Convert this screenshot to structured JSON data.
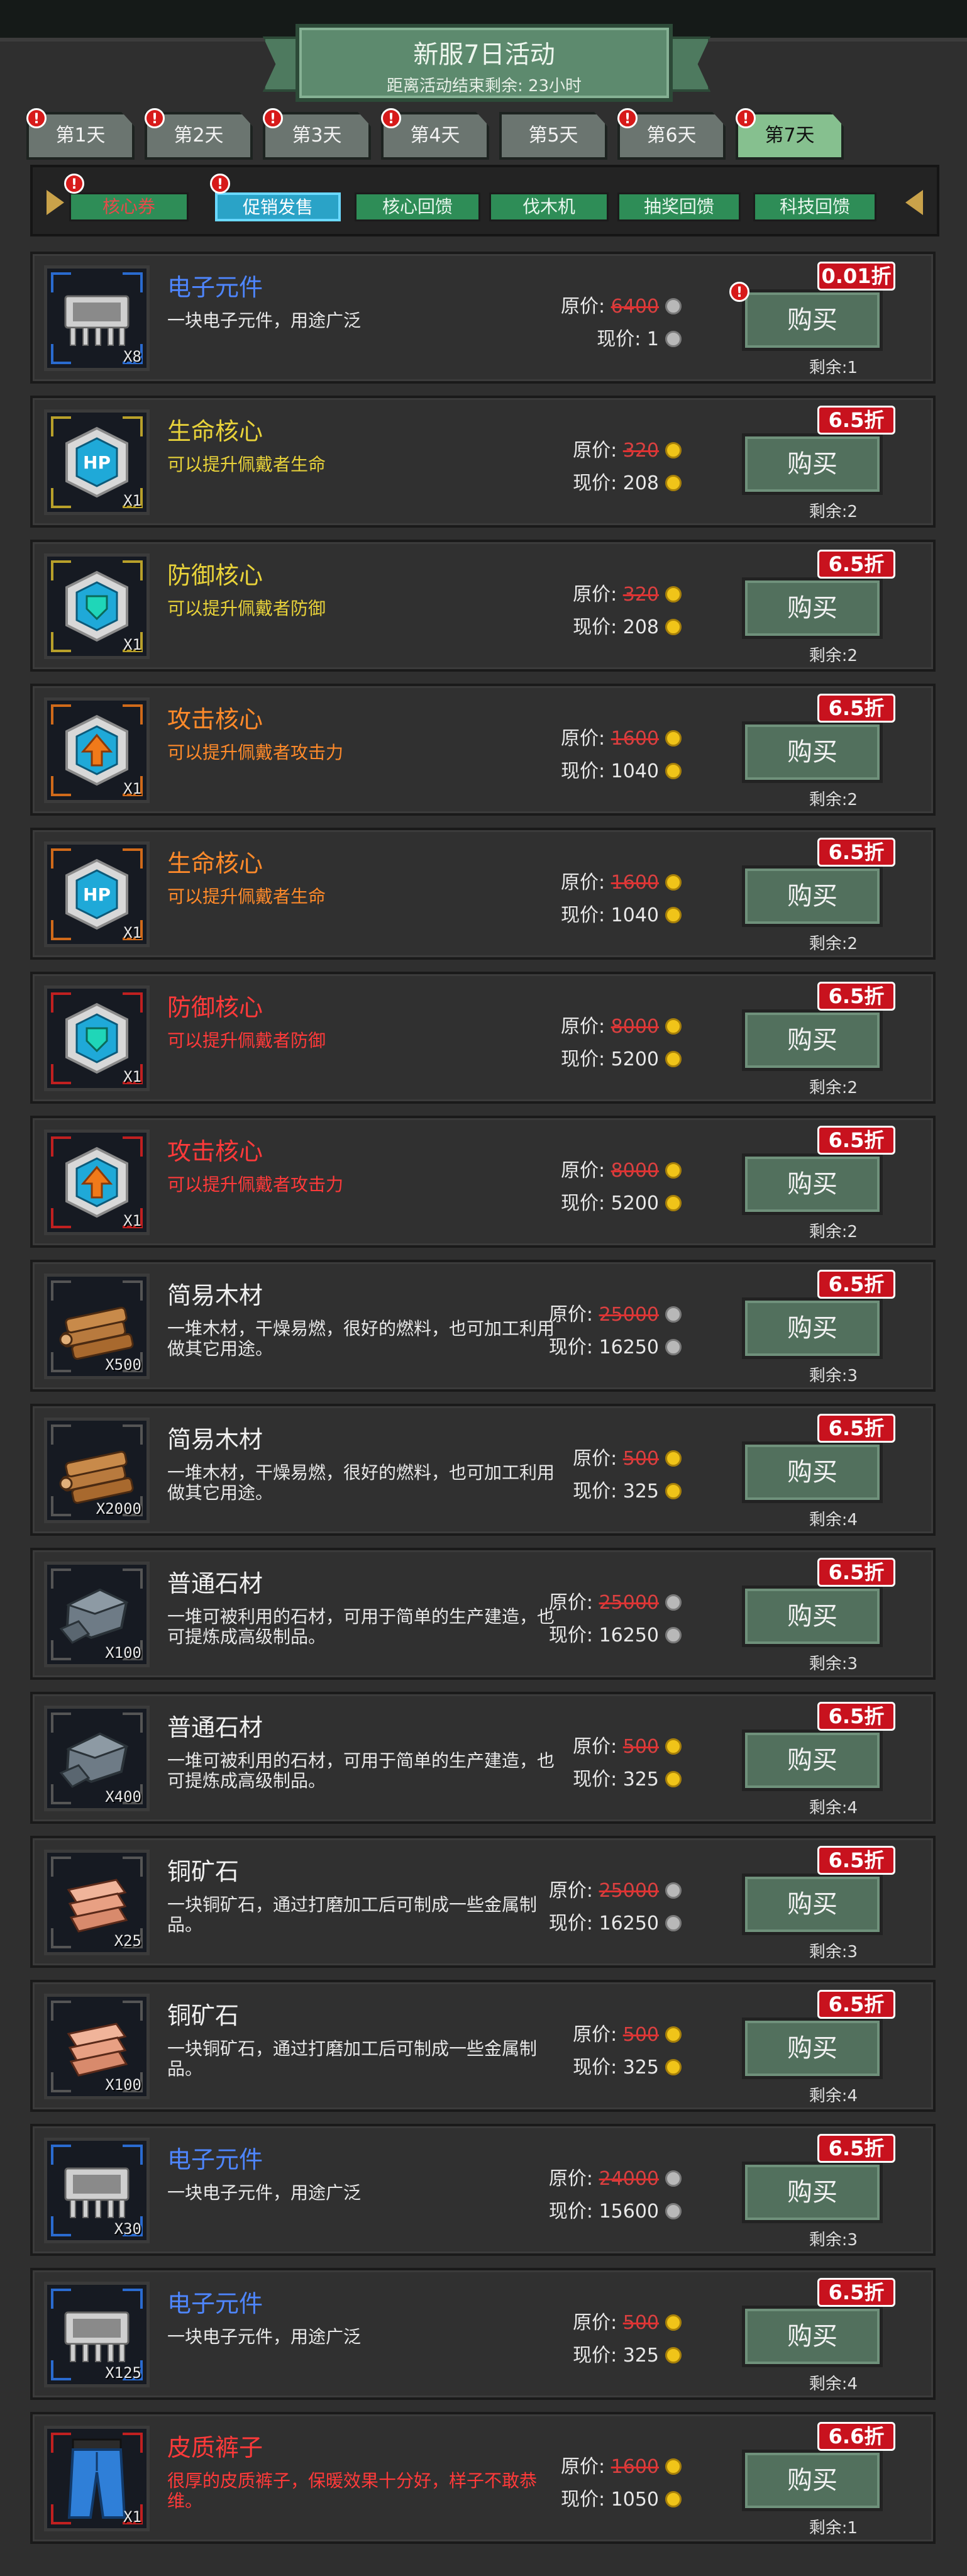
{
  "header": {
    "title": "新服7日活动",
    "subtitle": "距离活动结束剩余: 23小时"
  },
  "day_tabs": [
    {
      "label": "第1天",
      "alert": true,
      "active": false
    },
    {
      "label": "第2天",
      "alert": true,
      "active": false
    },
    {
      "label": "第3天",
      "alert": true,
      "active": false
    },
    {
      "label": "第4天",
      "alert": true,
      "active": false
    },
    {
      "label": "第5天",
      "alert": false,
      "active": false
    },
    {
      "label": "第6天",
      "alert": true,
      "active": false
    },
    {
      "label": "第7天",
      "alert": true,
      "active": true
    }
  ],
  "categories": [
    {
      "label": "核心券",
      "alert": true,
      "style": "red"
    },
    {
      "label": "促销发售",
      "alert": true,
      "style": "sel"
    },
    {
      "label": "核心回馈",
      "alert": false,
      "style": "normal"
    },
    {
      "label": "伐木机",
      "alert": false,
      "style": "normal"
    },
    {
      "label": "抽奖回馈",
      "alert": false,
      "style": "normal"
    },
    {
      "label": "科技回馈",
      "alert": false,
      "style": "normal"
    }
  ],
  "labels": {
    "original": "原价:",
    "current": "现价:",
    "remaining": "剩余:",
    "buy": "购买",
    "alert_mark": "!"
  },
  "items": [
    {
      "name": "电子元件",
      "name_color": "#4e86ff",
      "desc": "一块电子元件，用途广泛",
      "desc_color": "#e8e8e8",
      "qty": "X8",
      "icon": "chip-icon",
      "frame": "#2a6bd0",
      "orig": "6400",
      "cur": "1",
      "currency": "silver",
      "discount": "0.01折",
      "remain": "1",
      "buy_alert": true
    },
    {
      "name": "生命核心",
      "name_color": "#e8d23a",
      "desc": "可以提升佩戴者生命",
      "desc_color": "#e8d23a",
      "qty": "X1",
      "icon": "hp-core-icon",
      "frame": "#b8a02a",
      "orig": "320",
      "cur": "208",
      "currency": "gold",
      "discount": "6.5折",
      "remain": "2",
      "buy_alert": false
    },
    {
      "name": "防御核心",
      "name_color": "#e8d23a",
      "desc": "可以提升佩戴者防御",
      "desc_color": "#e8d23a",
      "qty": "X1",
      "icon": "defense-core-icon",
      "frame": "#b8a02a",
      "orig": "320",
      "cur": "208",
      "currency": "gold",
      "discount": "6.5折",
      "remain": "2",
      "buy_alert": false
    },
    {
      "name": "攻击核心",
      "name_color": "#ff8a2a",
      "desc": "可以提升佩戴者攻击力",
      "desc_color": "#ff8a2a",
      "qty": "X1",
      "icon": "attack-core-icon",
      "frame": "#d06a1a",
      "orig": "1600",
      "cur": "1040",
      "currency": "gold",
      "discount": "6.5折",
      "remain": "2",
      "buy_alert": false
    },
    {
      "name": "生命核心",
      "name_color": "#ff8a2a",
      "desc": "可以提升佩戴者生命",
      "desc_color": "#ff8a2a",
      "qty": "X1",
      "icon": "hp-core-icon",
      "frame": "#d06a1a",
      "orig": "1600",
      "cur": "1040",
      "currency": "gold",
      "discount": "6.5折",
      "remain": "2",
      "buy_alert": false
    },
    {
      "name": "防御核心",
      "name_color": "#ff3a3a",
      "desc": "可以提升佩戴者防御",
      "desc_color": "#ff3a3a",
      "qty": "X1",
      "icon": "defense-core-icon",
      "frame": "#c02020",
      "orig": "8000",
      "cur": "5200",
      "currency": "gold",
      "discount": "6.5折",
      "remain": "2",
      "buy_alert": false
    },
    {
      "name": "攻击核心",
      "name_color": "#ff3a3a",
      "desc": "可以提升佩戴者攻击力",
      "desc_color": "#ff3a3a",
      "qty": "X1",
      "icon": "attack-core-icon",
      "frame": "#c02020",
      "orig": "8000",
      "cur": "5200",
      "currency": "gold",
      "discount": "6.5折",
      "remain": "2",
      "buy_alert": false
    },
    {
      "name": "简易木材",
      "name_color": "#f0f0f0",
      "desc": "一堆木材，干燥易燃，很好的燃料，也可加工利用做其它用途。",
      "desc_color": "#e8e8e8",
      "qty": "X500",
      "icon": "wood-icon",
      "frame": "#555555",
      "orig": "25000",
      "cur": "16250",
      "currency": "silver",
      "discount": "6.5折",
      "remain": "3",
      "buy_alert": false
    },
    {
      "name": "简易木材",
      "name_color": "#f0f0f0",
      "desc": "一堆木材，干燥易燃，很好的燃料，也可加工利用做其它用途。",
      "desc_color": "#e8e8e8",
      "qty": "X2000",
      "icon": "wood-icon",
      "frame": "#555555",
      "orig": "500",
      "cur": "325",
      "currency": "gold",
      "discount": "6.5折",
      "remain": "4",
      "buy_alert": false
    },
    {
      "name": "普通石材",
      "name_color": "#f0f0f0",
      "desc": "一堆可被利用的石材，可用于简单的生产建造，也可提炼成高级制品。",
      "desc_color": "#e8e8e8",
      "qty": "X100",
      "icon": "stone-icon",
      "frame": "#555555",
      "orig": "25000",
      "cur": "16250",
      "currency": "silver",
      "discount": "6.5折",
      "remain": "3",
      "buy_alert": false
    },
    {
      "name": "普通石材",
      "name_color": "#f0f0f0",
      "desc": "一堆可被利用的石材，可用于简单的生产建造，也可提炼成高级制品。",
      "desc_color": "#e8e8e8",
      "qty": "X400",
      "icon": "stone-icon",
      "frame": "#555555",
      "orig": "500",
      "cur": "325",
      "currency": "gold",
      "discount": "6.5折",
      "remain": "4",
      "buy_alert": false
    },
    {
      "name": "铜矿石",
      "name_color": "#f0f0f0",
      "desc": "一块铜矿石，通过打磨加工后可制成一些金属制品。",
      "desc_color": "#e8e8e8",
      "qty": "X25",
      "icon": "copper-ore-icon",
      "frame": "#555555",
      "orig": "25000",
      "cur": "16250",
      "currency": "silver",
      "discount": "6.5折",
      "remain": "3",
      "buy_alert": false
    },
    {
      "name": "铜矿石",
      "name_color": "#f0f0f0",
      "desc": "一块铜矿石，通过打磨加工后可制成一些金属制品。",
      "desc_color": "#e8e8e8",
      "qty": "X100",
      "icon": "copper-ore-icon",
      "frame": "#555555",
      "orig": "500",
      "cur": "325",
      "currency": "gold",
      "discount": "6.5折",
      "remain": "4",
      "buy_alert": false
    },
    {
      "name": "电子元件",
      "name_color": "#4e86ff",
      "desc": "一块电子元件，用途广泛",
      "desc_color": "#e8e8e8",
      "qty": "X30",
      "icon": "chip-icon",
      "frame": "#2a6bd0",
      "orig": "24000",
      "cur": "15600",
      "currency": "silver",
      "discount": "6.5折",
      "remain": "3",
      "buy_alert": false
    },
    {
      "name": "电子元件",
      "name_color": "#4e86ff",
      "desc": "一块电子元件，用途广泛",
      "desc_color": "#e8e8e8",
      "qty": "X125",
      "icon": "chip-icon",
      "frame": "#2a6bd0",
      "orig": "500",
      "cur": "325",
      "currency": "gold",
      "discount": "6.5折",
      "remain": "4",
      "buy_alert": false
    },
    {
      "name": "皮质裤子",
      "name_color": "#ff3a3a",
      "desc": "很厚的皮质裤子，保暖效果十分好，样子不敢恭维。",
      "desc_color": "#ff3a3a",
      "qty": "X1",
      "icon": "leather-pants-icon",
      "frame": "#c02020",
      "orig": "1600",
      "cur": "1050",
      "currency": "gold",
      "discount": "6.6折",
      "remain": "1",
      "buy_alert": false
    }
  ]
}
